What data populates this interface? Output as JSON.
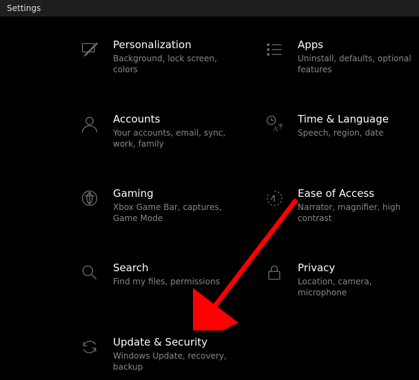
{
  "window": {
    "title": "Settings"
  },
  "categories": {
    "personalization": {
      "label": "Personalization",
      "desc": "Background, lock screen, colors"
    },
    "apps": {
      "label": "Apps",
      "desc": "Uninstall, defaults, optional features"
    },
    "accounts": {
      "label": "Accounts",
      "desc": "Your accounts, email, sync, work, family"
    },
    "time": {
      "label": "Time & Language",
      "desc": "Speech, region, date"
    },
    "gaming": {
      "label": "Gaming",
      "desc": "Xbox Game Bar, captures, Game Mode"
    },
    "ease": {
      "label": "Ease of Access",
      "desc": "Narrator, magnifier, high contrast"
    },
    "search": {
      "label": "Search",
      "desc": "Find my files, permissions"
    },
    "privacy": {
      "label": "Privacy",
      "desc": "Location, camera, microphone"
    },
    "update": {
      "label": "Update & Security",
      "desc": "Windows Update, recovery, backup"
    }
  }
}
